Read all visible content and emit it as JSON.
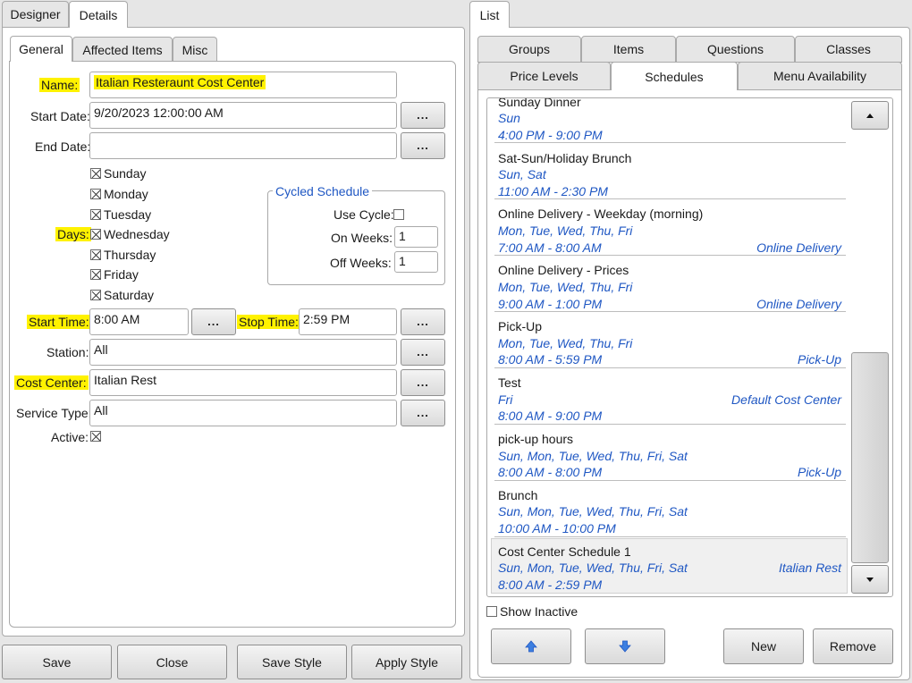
{
  "left": {
    "top_tabs": [
      "Designer",
      "Details"
    ],
    "sub_tabs": [
      "General",
      "Affected Items",
      "Misc"
    ],
    "form": {
      "name_label": "Name:",
      "name_value": "Italian Resteraunt Cost Center",
      "start_date_label": "Start Date:",
      "start_date_value": "9/20/2023 12:00:00 AM",
      "end_date_label": "End Date:",
      "end_date_value": "",
      "days_label": "Days:",
      "days": [
        {
          "label": "Sunday",
          "checked": true
        },
        {
          "label": "Monday",
          "checked": true
        },
        {
          "label": "Tuesday",
          "checked": true
        },
        {
          "label": "Wednesday",
          "checked": true
        },
        {
          "label": "Thursday",
          "checked": true
        },
        {
          "label": "Friday",
          "checked": true
        },
        {
          "label": "Saturday",
          "checked": true
        }
      ],
      "cycled_title": "Cycled Schedule",
      "use_cycle_label": "Use Cycle:",
      "on_weeks_label": "On Weeks:",
      "on_weeks_value": "1",
      "off_weeks_label": "Off Weeks:",
      "off_weeks_value": "1",
      "start_time_label": "Start Time:",
      "start_time_value": "8:00 AM",
      "stop_time_label": "Stop Time:",
      "stop_time_value": "2:59 PM",
      "station_label": "Station:",
      "station_value": "All",
      "cost_center_label": "Cost Center:",
      "cost_center_value": "Italian Rest",
      "service_type_label": "Service Type:",
      "service_type_value": "All",
      "active_label": "Active:",
      "ellipsis": "..."
    },
    "buttons": [
      "Save",
      "Close",
      "Save Style",
      "Apply Style"
    ]
  },
  "right": {
    "top_tab": "List",
    "tabs_row1": [
      "Groups",
      "Items",
      "Questions",
      "Classes"
    ],
    "tabs_row2": [
      "Price Levels",
      "Schedules",
      "Menu Availability"
    ],
    "schedules": [
      {
        "name": "Sunday Dinner",
        "days": "Sun",
        "time": "4:00 PM - 9:00 PM",
        "tag": ""
      },
      {
        "name": "Sat-Sun/Holiday Brunch",
        "days": "Sun, Sat",
        "time": "11:00 AM - 2:30 PM",
        "tag": ""
      },
      {
        "name": "Online Delivery - Weekday (morning)",
        "days": "Mon, Tue, Wed, Thu, Fri",
        "time": "7:00 AM - 8:00 AM",
        "tag": "Online Delivery"
      },
      {
        "name": "Online Delivery - Prices",
        "days": "Mon, Tue, Wed, Thu, Fri",
        "time": "9:00 AM - 1:00 PM",
        "tag": "Online Delivery"
      },
      {
        "name": "Pick-Up",
        "days": "Mon, Tue, Wed, Thu, Fri",
        "time": "8:00 AM - 5:59 PM",
        "tag": "Pick-Up"
      },
      {
        "name": "Test",
        "days": "Fri",
        "time": "8:00 AM - 9:00 PM",
        "tag": "Default Cost Center"
      },
      {
        "name": "pick-up hours",
        "days": "Sun, Mon, Tue, Wed, Thu, Fri, Sat",
        "time": "8:00 AM - 8:00 PM",
        "tag": "Pick-Up"
      },
      {
        "name": "Brunch",
        "days": "Sun, Mon, Tue, Wed, Thu, Fri, Sat",
        "time": "10:00 AM - 10:00 PM",
        "tag": ""
      },
      {
        "name": "Cost Center Schedule 1",
        "days": "Sun, Mon, Tue, Wed, Thu, Fri, Sat",
        "time": "8:00 AM - 2:59 PM",
        "tag": "Italian Rest"
      }
    ],
    "show_inactive_label": "Show Inactive",
    "new_label": "New",
    "remove_label": "Remove"
  },
  "colors": {
    "highlight": "#fff200",
    "accent_text": "#1f57c3"
  }
}
